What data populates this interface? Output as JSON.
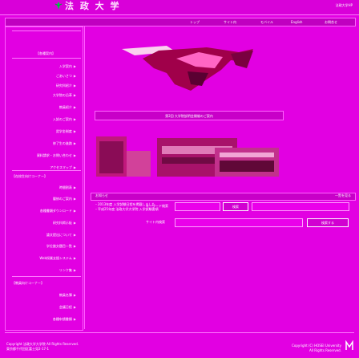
{
  "header": {
    "logo_text": "法 政 大 学",
    "univ_link": "法政大学HP"
  },
  "global_nav": [
    "トップ",
    "サイト内",
    "モバイル",
    "English",
    "お問合せ"
  ],
  "sidebar": {
    "section1_title": "【各種案内】",
    "section1_items": [
      "入学案内",
      "ごあいさつ",
      "研究科紹介",
      "大学院の沿革",
      "教員紹介",
      "入試のご案内",
      "奨学金制度",
      "修了生の進路",
      "資料請求・お問い合わせ",
      "アクセスマップ"
    ],
    "section2_title": "【在校生向けコーナー】",
    "section2_items": [
      "時間割表",
      "履修のご案内",
      "各種書類ダウンロード",
      "研究科掲示板",
      "論文提出について",
      "学位論文題目一覧",
      "Web授業支援システム",
      "リンク集"
    ],
    "section3_title": "【教員向けコーナー】",
    "section3_items": [
      "教員名簿",
      "会議日程",
      "各種申請書類"
    ]
  },
  "main": {
    "caption": "第2回 大学院説明会開催のご案内",
    "news_title": "お知らせ",
    "news_more": "一覧を見る",
    "news_line1": "・2013年度 入学試験日程を掲載しました",
    "news_line2": "・平成25年度 法政大学大学院 入学試験要項",
    "search_label1": "キーワード検索",
    "search_button1": "検索",
    "search_label2": "サイト内検索",
    "search_button2": "検索する"
  },
  "footer": {
    "left1": "Copyright 法政大学大学院 All Rights Reserved.",
    "left2": "東京都千代田区富士見2-17-1",
    "right1": "Copyright (C) HOSEI University",
    "right2": "All Rights Reserved."
  },
  "colors": {
    "background": "#e200e2",
    "accent": "#c800c8"
  }
}
